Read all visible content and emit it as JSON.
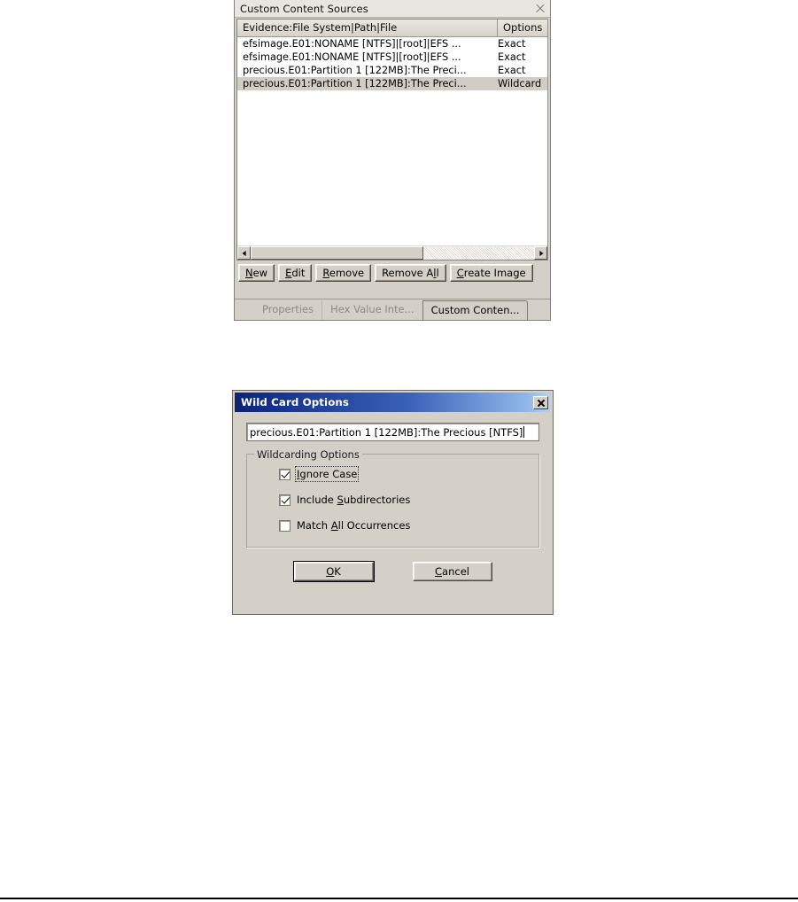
{
  "custom_content_sources": {
    "title": "Custom Content Sources",
    "close_icon": "close-icon",
    "columns": {
      "evidence": "Evidence:File System|Path|File",
      "options": "Options"
    },
    "rows": [
      {
        "evidence": "efsimage.E01:NONAME [NTFS]|[root]|EFS ...",
        "options": "Exact",
        "selected": false
      },
      {
        "evidence": "efsimage.E01:NONAME [NTFS]|[root]|EFS ...",
        "options": "Exact",
        "selected": false
      },
      {
        "evidence": "precious.E01:Partition 1 [122MB]:The Preci...",
        "options": "Exact",
        "selected": false
      },
      {
        "evidence": "precious.E01:Partition 1 [122MB]:The Preci...",
        "options": "Wildcard",
        "selected": true
      }
    ],
    "scrollbar": {
      "left_arrow_icon": "arrow-left-icon",
      "right_arrow_icon": "arrow-right-icon"
    },
    "buttons": [
      {
        "label": "New",
        "accel": "N"
      },
      {
        "label": "Edit",
        "accel": "E"
      },
      {
        "label": "Remove",
        "accel": "R"
      },
      {
        "label": "Remove All",
        "accel": "A"
      },
      {
        "label": "Create Image",
        "accel": "C"
      }
    ],
    "tabs": [
      {
        "label": "Properties",
        "active": false
      },
      {
        "label": "Hex Value Inte...",
        "active": false
      },
      {
        "label": "Custom Conten...",
        "active": true
      }
    ]
  },
  "wild_card_options": {
    "title": "Wild Card Options",
    "close_icon": "close-icon",
    "path_value": "precious.E01:Partition 1 [122MB]:The Precious [NTFS]",
    "group_label": "Wildcarding Options",
    "checkboxes": [
      {
        "label": "Ignore Case",
        "accel": "I",
        "checked": true,
        "focused": true
      },
      {
        "label": "Include Subdirectories",
        "accel": "S",
        "checked": true,
        "focused": false
      },
      {
        "label": "Match All Occurrences",
        "accel": "A",
        "checked": false,
        "focused": false
      }
    ],
    "ok_label": "OK",
    "ok_accel": "O",
    "cancel_label": "Cancel",
    "cancel_accel": "C"
  },
  "colors": {
    "dialog_face": "#d4d0c8",
    "titlebar_active_start": "#0b2472",
    "titlebar_active_end": "#b5d2f2",
    "selection": "#d1cdc5"
  }
}
